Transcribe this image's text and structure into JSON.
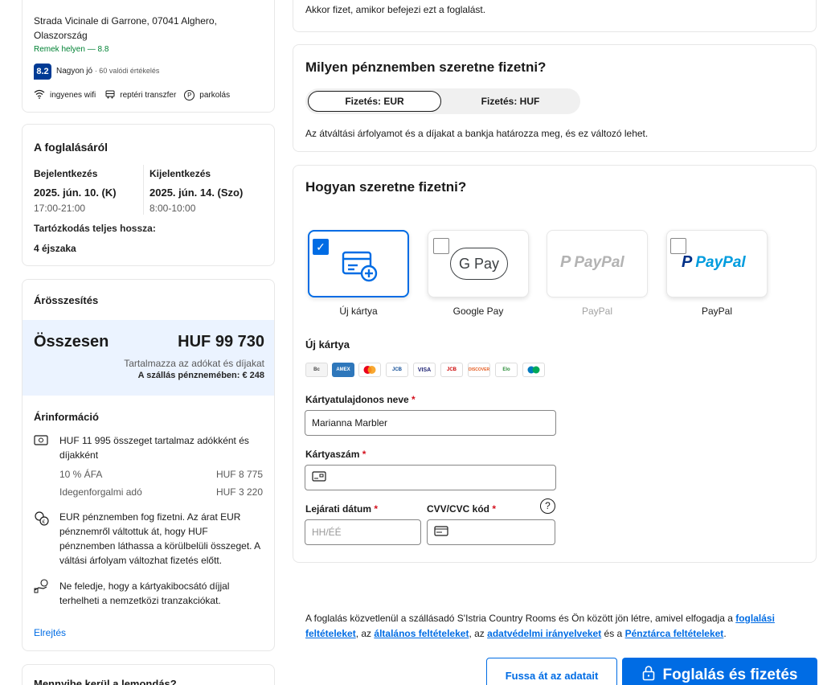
{
  "hotel": {
    "address": "Strada Vicinale di Garrone, 07041 Alghero, Olaszország",
    "location_note": "Remek helyen — 8.8",
    "score": "8.2",
    "score_label": "Nagyon jó",
    "reviews": "· 60 valódi értékelés",
    "amenities": [
      "ingyenes wifi",
      "reptéri transzfer",
      "parkolás"
    ]
  },
  "booking": {
    "title": "A foglalásáról",
    "checkin_label": "Bejelentkezés",
    "checkin_date": "2025. jún. 10. (K)",
    "checkin_time": "17:00-21:00",
    "checkout_label": "Kijelentkezés",
    "checkout_date": "2025. jún. 14. (Szo)",
    "checkout_time": "8:00-10:00",
    "stay_label": "Tartózkodás teljes hossza:",
    "stay_value": "4 éjszaka"
  },
  "price": {
    "title": "Árösszesítés",
    "total_label": "Összesen",
    "total_value": "HUF 99 730",
    "incl_note": "Tartalmazza az adókat és díjakat",
    "local_currency": "A szállás pénznemében: € 248",
    "info_title": "Árinformáció",
    "taxes_text": "HUF 11 995 összeget tartalmaz adókként és díjakként",
    "vat_label": "10 % ÁFA",
    "vat_value": "HUF 8 775",
    "tourist_label": "Idegenforgalmi adó",
    "tourist_value": "HUF 3 220",
    "eur_note": "EUR pénznemben fog fizetni. Az árat EUR pénznemről váltottuk át, hogy HUF pénznemben láthassa a körülbelüli összeget. A váltási árfolyam változhat fizetés előtt.",
    "fee_note": "Ne feledje, hogy a kártyakibocsátó díjjal terhelheti a nemzetközi tranzakciókat.",
    "hide_link": "Elrejtés",
    "cancel_title": "Mennyibe kerül a lemondás?"
  },
  "top_note": "Akkor fizet, amikor befejezi ezt a foglalást.",
  "currency": {
    "title": "Milyen pénznemben szeretne fizetni?",
    "opt_eur": "Fizetés: EUR",
    "opt_huf": "Fizetés: HUF",
    "note": "Az átváltási árfolyamot és a díjakat a bankja határozza meg, és ez változó lehet."
  },
  "payment": {
    "title": "Hogyan szeretne fizetni?",
    "methods": [
      "Új kártya",
      "Google Pay",
      "PayPal",
      "PayPal"
    ],
    "gpay_text": "G Pay",
    "paypal_text": "PayPal",
    "new_card_title": "Új kártya",
    "card_logos": [
      "Bancontact",
      "AMEX",
      "MC",
      "JCB",
      "VISA",
      "JCB",
      "DISCOVER",
      "Elo",
      "Diners"
    ],
    "holder_label": "Kártyatulajdonos neve",
    "holder_value": "Marianna Marbler",
    "number_label": "Kártyaszám",
    "expiry_label": "Lejárati dátum",
    "expiry_placeholder": "HH/ÉÉ",
    "cvc_label": "CVV/CVC kód",
    "required_mark": "*"
  },
  "terms": {
    "p1": "A foglalás közvetlenül a szállásadó S'Istria Country Rooms és Ön között jön létre, amivel elfogadja a ",
    "l1": "foglalási feltételeket",
    "p2": ", az ",
    "l2": "általános feltételeket",
    "p3": ", az ",
    "l3": "adatvédelmi irányelveket",
    "p4": " és a ",
    "l4": "Pénztárca feltételeket",
    "p5": "."
  },
  "buttons": {
    "review": "Fussa át az adatait",
    "book": "Foglalás és fizetés"
  },
  "colors": {
    "brand_blue": "#006ce4",
    "green": "#008234",
    "score_bg": "#003b95",
    "summary_bg": "#ebf3ff"
  }
}
